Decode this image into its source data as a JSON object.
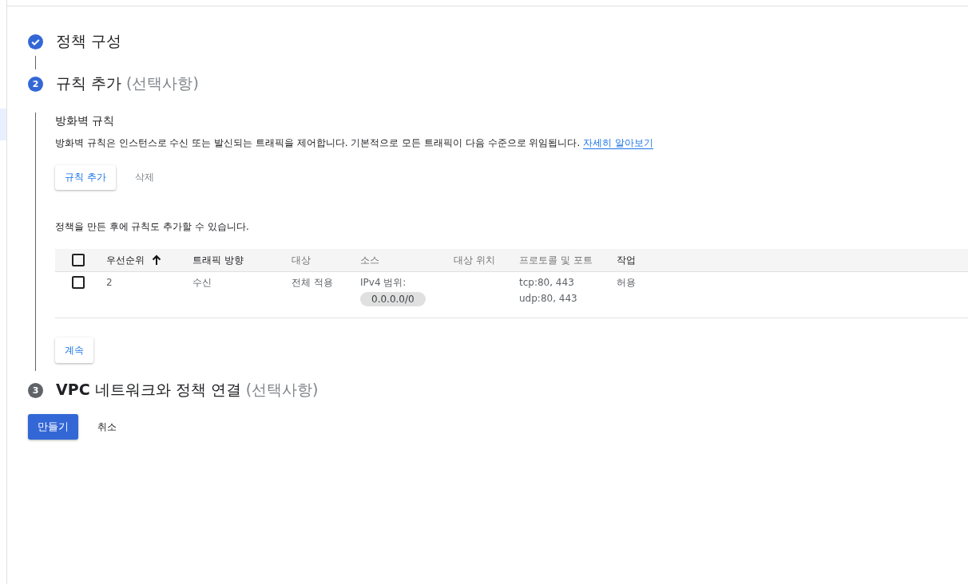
{
  "steps": [
    {
      "completed": true,
      "active": false,
      "title": "정책 구성"
    },
    {
      "completed": false,
      "active": true,
      "number": "2",
      "title": "규칙 추가",
      "optional": "(선택사항)"
    },
    {
      "completed": false,
      "active": false,
      "number": "3",
      "title": "**VPC** 네트워크와 정책 연결",
      "optional": "(선택사항)"
    }
  ],
  "firewall": {
    "heading": "방화벽 규칙",
    "description": "방화벽 규칙은 인스턴스로 수신 또는 발신되는 트래픽을 제어합니다. 기본적으로 모든 트래픽이 다음 수준으로 위임됩니다.",
    "link": "자세히 알아보기",
    "buttons": [
      {
        "label": "규칙 추가",
        "disabled": false
      },
      {
        "label": "삭제",
        "disabled": true
      }
    ],
    "note": "정책을 만든 후에 규칙도 추가할 수 있습니다.",
    "table": {
      "select_all": {
        "checked": false
      },
      "columns": [
        {
          "label": "우선순위",
          "dim": false,
          "sorted_ascending": true
        },
        {
          "label": "트래픽 방향",
          "dim": false
        },
        {
          "label": "대상",
          "dim": true
        },
        {
          "label": "소스",
          "dim": true
        },
        {
          "label": "대상 위치",
          "dim": true
        },
        {
          "label": "프로토콜 및 포트",
          "dim": true
        },
        {
          "label": "작업",
          "dim": false
        }
      ],
      "rows": [
        {
          "checked": false,
          "priority": "2",
          "direction": "수신",
          "target": "전체 적용",
          "source_label": "IPv4 범위:",
          "source_chip": "0.0.0.0/0",
          "protocols": [
            "tcp:80, 443",
            "udp:80, 443"
          ],
          "action": "허용"
        }
      ]
    },
    "continue_button": "계속"
  },
  "footer": {
    "create_button": "만들기",
    "cancel_button": "취소"
  }
}
